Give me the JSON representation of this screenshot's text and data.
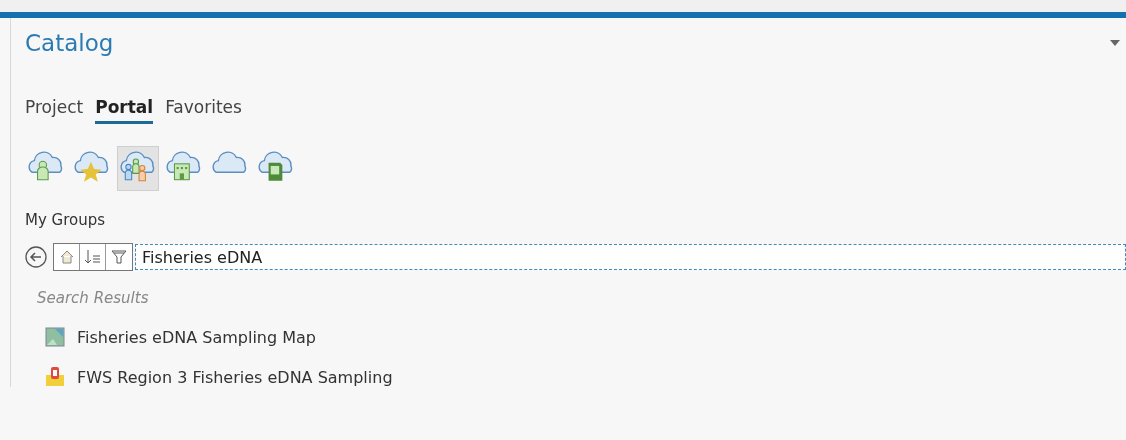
{
  "panel": {
    "title": "Catalog"
  },
  "tabs": [
    {
      "label": "Project",
      "selected": false
    },
    {
      "label": "Portal",
      "selected": true
    },
    {
      "label": "Favorites",
      "selected": false
    }
  ],
  "portal_buttons": [
    {
      "kind": "user",
      "selected": false
    },
    {
      "kind": "favorite",
      "selected": false
    },
    {
      "kind": "groups",
      "selected": true
    },
    {
      "kind": "organization",
      "selected": false
    },
    {
      "kind": "online",
      "selected": false
    },
    {
      "kind": "living-atlas",
      "selected": false
    }
  ],
  "section_title": "My Groups",
  "search": {
    "value": "Fisheries eDNA"
  },
  "results_heading": "Search Results",
  "results": [
    {
      "kind": "map",
      "label": "Fisheries eDNA Sampling Map"
    },
    {
      "kind": "layer",
      "label": "FWS Region 3 Fisheries eDNA Sampling"
    }
  ]
}
